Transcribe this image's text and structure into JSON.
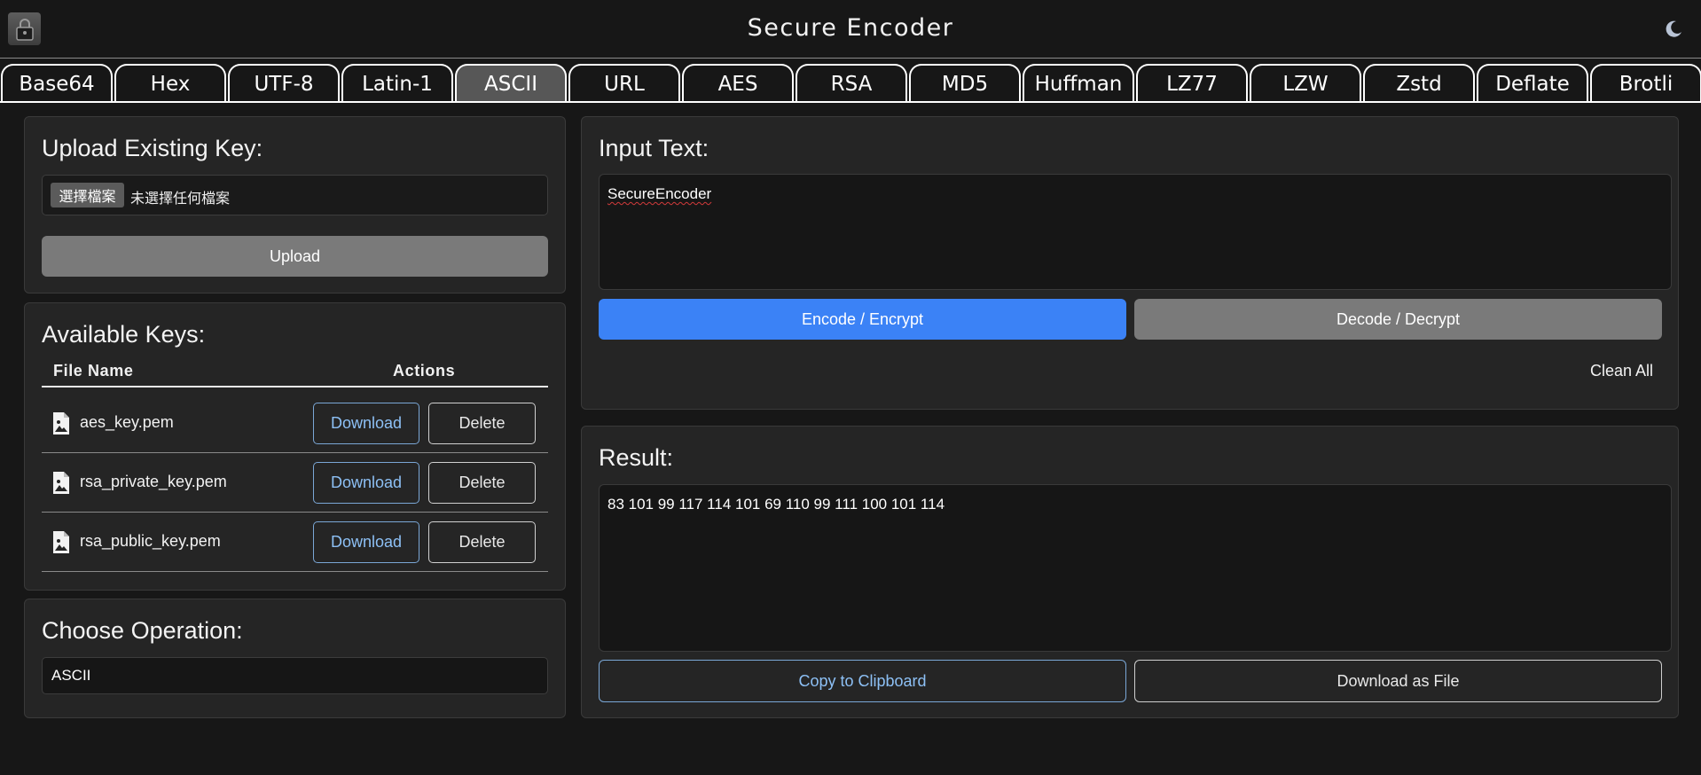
{
  "header": {
    "title": "Secure Encoder",
    "logo_icon": "lock-icon",
    "theme_icon": "moon-icon"
  },
  "tabs": [
    {
      "label": "Base64",
      "active": false
    },
    {
      "label": "Hex",
      "active": false
    },
    {
      "label": "UTF-8",
      "active": false
    },
    {
      "label": "Latin-1",
      "active": false
    },
    {
      "label": "ASCII",
      "active": true
    },
    {
      "label": "URL",
      "active": false
    },
    {
      "label": "AES",
      "active": false
    },
    {
      "label": "RSA",
      "active": false
    },
    {
      "label": "MD5",
      "active": false
    },
    {
      "label": "Huffman",
      "active": false
    },
    {
      "label": "LZ77",
      "active": false
    },
    {
      "label": "LZW",
      "active": false
    },
    {
      "label": "Zstd",
      "active": false
    },
    {
      "label": "Deflate",
      "active": false
    },
    {
      "label": "Brotli",
      "active": false
    }
  ],
  "upload": {
    "title": "Upload Existing Key:",
    "choose_label": "選擇檔案",
    "no_file_label": "未選擇任何檔案",
    "upload_label": "Upload"
  },
  "keys": {
    "title": "Available Keys:",
    "col_file": "File Name",
    "col_actions": "Actions",
    "download_label": "Download",
    "delete_label": "Delete",
    "rows": [
      {
        "name": "aes_key.pem"
      },
      {
        "name": "rsa_private_key.pem"
      },
      {
        "name": "rsa_public_key.pem"
      }
    ]
  },
  "operation": {
    "title": "Choose Operation:",
    "selected": "ASCII"
  },
  "input": {
    "title": "Input Text:",
    "value": "SecureEncoder",
    "encode_label": "Encode / Encrypt",
    "decode_label": "Decode / Decrypt",
    "clean_label": "Clean All"
  },
  "result": {
    "title": "Result:",
    "value": "83 101 99 117 114 101 69 110 99 111 100 101 114",
    "copy_label": "Copy to Clipboard",
    "download_label": "Download as File"
  },
  "colors": {
    "background": "#171717",
    "panel": "#252525",
    "accent": "#3b82f6",
    "link": "#8dc0f5",
    "active_tab": "#575757"
  }
}
